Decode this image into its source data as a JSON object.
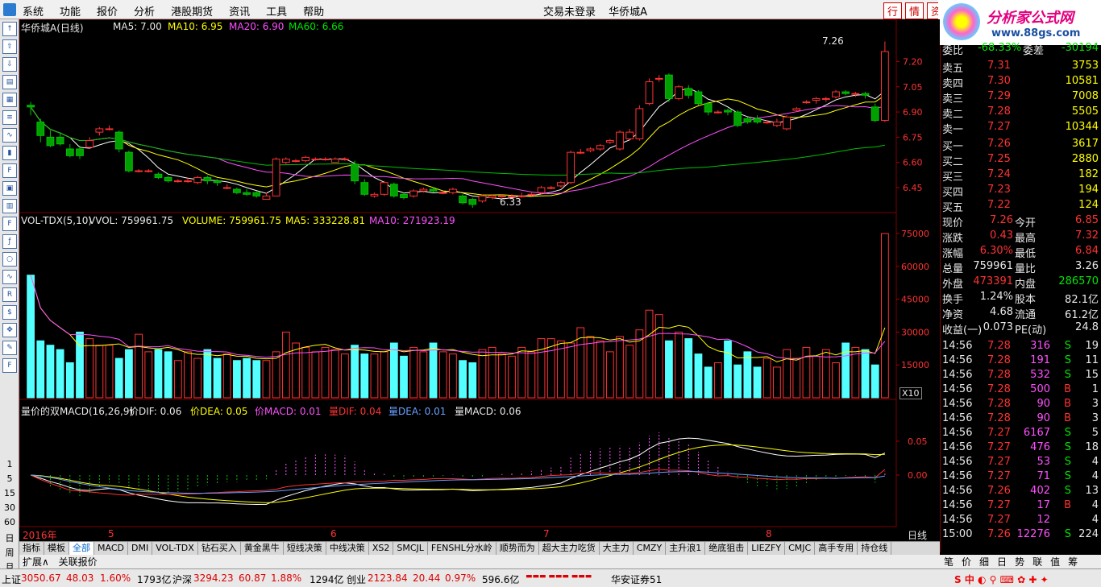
{
  "menu": {
    "items": [
      "系统",
      "功能",
      "报价",
      "分析",
      "港股期货",
      "资讯",
      "工具",
      "帮助"
    ],
    "login": "交易未登录",
    "stock_name": "华侨城A",
    "tab_quote": "行",
    "tab_info": "情",
    "tab_misc": "资"
  },
  "brand": {
    "title": "分析家公式网",
    "url": "www.88gs.com"
  },
  "stock_title": "华侨城A(日线)",
  "ma": {
    "ma5": "MA5: 7.00",
    "ma10": "MA10: 6.95",
    "ma20": "MA20: 6.90",
    "ma60": "MA60: 6.66"
  },
  "price_axis": [
    "7.20",
    "7.05",
    "6.90",
    "6.75",
    "6.60",
    "6.45"
  ],
  "price_annot": {
    "high": "7.26",
    "low": "6.33"
  },
  "vol_header": {
    "name": "VOL-TDX(5,10)",
    "vvol": "VVOL: 759961.75",
    "volume": "VOLUME: 759961.75",
    "ma5": "MA5: 333228.81",
    "ma10": "MA10: 271923.19"
  },
  "vol_axis": [
    "75000",
    "60000",
    "45000",
    "30000",
    "15000"
  ],
  "vol_scale": "X10",
  "macd_header": {
    "name": "量价的双MACD(16,26,9)",
    "dif": "价DIF: 0.06",
    "dea": "价DEA: 0.05",
    "macd": "价MACD: 0.01",
    "qdif": "量DIF: 0.04",
    "qdea": "量DEA: 0.01",
    "qmacd": "量MACD: 0.06"
  },
  "macd_axis": [
    "0.05",
    "0.00"
  ],
  "x_axis": {
    "year": "2016年",
    "m5": "5",
    "m6": "6",
    "m7": "7",
    "m8": "8",
    "period": "日线"
  },
  "left_labels": [
    "1",
    "5",
    "15",
    "30",
    "60",
    "日",
    "周",
    "月"
  ],
  "tabs": [
    "指标",
    "模板",
    "全部",
    "MACD",
    "DMI",
    "VOL-TDX",
    "钻石买入",
    "黄金黑牛",
    "短线决策",
    "中线决策",
    "XS2",
    "SMCJL",
    "FENSHL分水岭",
    "顺势而为",
    "超大主力吃货",
    "大主力",
    "CMZY",
    "主升浪1",
    "绝底狙击",
    "LIEZFY",
    "CMJC",
    "高手专用",
    "持仓线"
  ],
  "tabs_extra": [
    "扩展∧",
    "关联报价"
  ],
  "right_tabs": [
    "笔",
    "价",
    "细",
    "日",
    "势",
    "联",
    "值",
    "筹"
  ],
  "panel": {
    "ratio": {
      "label1": "委比",
      "val1": "-68.33%",
      "label2": "委差",
      "val2": "-30194"
    },
    "sell": [
      {
        "label": "卖五",
        "price": "7.31",
        "vol": "3753"
      },
      {
        "label": "卖四",
        "price": "7.30",
        "vol": "10581"
      },
      {
        "label": "卖三",
        "price": "7.29",
        "vol": "7008"
      },
      {
        "label": "卖二",
        "price": "7.28",
        "vol": "5505"
      },
      {
        "label": "卖一",
        "price": "7.27",
        "vol": "10344"
      }
    ],
    "buy": [
      {
        "label": "买一",
        "price": "7.26",
        "vol": "3617"
      },
      {
        "label": "买二",
        "price": "7.25",
        "vol": "2880"
      },
      {
        "label": "买三",
        "price": "7.24",
        "vol": "182"
      },
      {
        "label": "买四",
        "price": "7.23",
        "vol": "194"
      },
      {
        "label": "买五",
        "price": "7.22",
        "vol": "124"
      }
    ],
    "stats": [
      {
        "l1": "现价",
        "v1": "7.26",
        "l2": "今开",
        "v2": "6.85"
      },
      {
        "l1": "涨跌",
        "v1": "0.43",
        "l2": "最高",
        "v2": "7.32"
      },
      {
        "l1": "涨幅",
        "v1": "6.30%",
        "l2": "最低",
        "v2": "6.84"
      },
      {
        "l1": "总量",
        "v1": "759961",
        "l2": "量比",
        "v2": "3.26"
      },
      {
        "l1": "外盘",
        "v1": "473391",
        "l2": "内盘",
        "v2": "286570"
      },
      {
        "l1": "换手",
        "v1": "1.24%",
        "l2": "股本",
        "v2": "82.1亿"
      },
      {
        "l1": "净资",
        "v1": "4.68",
        "l2": "流通",
        "v2": "61.2亿"
      },
      {
        "l1": "收益(一)",
        "v1": "0.073",
        "l2": "PE(动)",
        "v2": "24.8"
      }
    ],
    "ticks": [
      {
        "t": "14:56",
        "p": "7.28",
        "v": "316",
        "bs": "S",
        "n": "19"
      },
      {
        "t": "14:56",
        "p": "7.28",
        "v": "191",
        "bs": "S",
        "n": "11"
      },
      {
        "t": "14:56",
        "p": "7.28",
        "v": "532",
        "bs": "S",
        "n": "15"
      },
      {
        "t": "14:56",
        "p": "7.28",
        "v": "500",
        "bs": "B",
        "n": "1"
      },
      {
        "t": "14:56",
        "p": "7.28",
        "v": "90",
        "bs": "B",
        "n": "3"
      },
      {
        "t": "14:56",
        "p": "7.28",
        "v": "90",
        "bs": "B",
        "n": "3"
      },
      {
        "t": "14:56",
        "p": "7.27",
        "v": "6167",
        "bs": "S",
        "n": "5"
      },
      {
        "t": "14:56",
        "p": "7.27",
        "v": "476",
        "bs": "S",
        "n": "18"
      },
      {
        "t": "14:56",
        "p": "7.27",
        "v": "53",
        "bs": "S",
        "n": "4"
      },
      {
        "t": "14:56",
        "p": "7.27",
        "v": "71",
        "bs": "S",
        "n": "4"
      },
      {
        "t": "14:56",
        "p": "7.26",
        "v": "402",
        "bs": "S",
        "n": "13"
      },
      {
        "t": "14:56",
        "p": "7.27",
        "v": "17",
        "bs": "B",
        "n": "4"
      },
      {
        "t": "14:56",
        "p": "7.27",
        "v": "12",
        "bs": "",
        "n": "4"
      },
      {
        "t": "15:00",
        "p": "7.26",
        "v": "12276",
        "bs": "S",
        "n": "224"
      }
    ]
  },
  "status": {
    "sh_label": "上证",
    "sh_val": "3050.67",
    "sh_chg": "48.03",
    "sh_pct": "1.60%",
    "sh_amt": "1793亿",
    "hs_label": "沪深",
    "hs_val": "3294.23",
    "hs_chg": "60.87",
    "hs_pct": "1.88%",
    "hs_amt": "1294亿",
    "cy_label": "创业",
    "cy_val": "2123.84",
    "cy_chg": "20.44",
    "cy_pct": "0.97%",
    "cy_amt": "596.6亿",
    "broker": "华安证券51"
  },
  "colors": {
    "up": "#ff3232",
    "down": "#00a000",
    "vol_down": "#54ffff",
    "ma5": "#ffffff",
    "ma10": "#ffff00",
    "ma20": "#ff50ff",
    "ma60": "#00c000"
  },
  "chart_data": {
    "type": "candlestick",
    "candles": [
      [
        6.94,
        6.93,
        6.96,
        6.88
      ],
      [
        6.84,
        6.76,
        6.86,
        6.72
      ],
      [
        6.75,
        6.7,
        6.79,
        6.69
      ],
      [
        6.75,
        6.71,
        6.78,
        6.7
      ],
      [
        6.68,
        6.64,
        6.71,
        6.63
      ],
      [
        6.68,
        6.64,
        6.7,
        6.62
      ],
      [
        6.69,
        6.73,
        6.75,
        6.68
      ],
      [
        6.78,
        6.8,
        6.81,
        6.76
      ],
      [
        6.8,
        6.8,
        6.82,
        6.79
      ],
      [
        6.78,
        6.68,
        6.79,
        6.66
      ],
      [
        6.66,
        6.55,
        6.67,
        6.54
      ],
      [
        6.55,
        6.55,
        6.56,
        6.54
      ],
      [
        6.55,
        6.55,
        6.56,
        6.54
      ],
      [
        6.53,
        6.51,
        6.54,
        6.5
      ],
      [
        6.51,
        6.49,
        6.52,
        6.48
      ],
      [
        6.49,
        6.49,
        6.5,
        6.48
      ],
      [
        6.49,
        6.49,
        6.51,
        6.48
      ],
      [
        6.48,
        6.51,
        6.52,
        6.47
      ],
      [
        6.51,
        6.49,
        6.52,
        6.47
      ],
      [
        6.49,
        6.48,
        6.5,
        6.46
      ],
      [
        6.45,
        6.45,
        6.47,
        6.44
      ],
      [
        6.44,
        6.42,
        6.45,
        6.41
      ],
      [
        6.42,
        6.41,
        6.44,
        6.4
      ],
      [
        6.42,
        6.4,
        6.43,
        6.39
      ],
      [
        6.38,
        6.4,
        6.42,
        6.38
      ],
      [
        6.4,
        6.62,
        6.63,
        6.4
      ],
      [
        6.6,
        6.62,
        6.63,
        6.59
      ],
      [
        6.61,
        6.61,
        6.62,
        6.6
      ],
      [
        6.61,
        6.63,
        6.64,
        6.6
      ],
      [
        6.62,
        6.62,
        6.63,
        6.61
      ],
      [
        6.62,
        6.62,
        6.63,
        6.61
      ],
      [
        6.6,
        6.62,
        6.63,
        6.6
      ],
      [
        6.62,
        6.62,
        6.63,
        6.61
      ],
      [
        6.59,
        6.49,
        6.61,
        6.47
      ],
      [
        6.48,
        6.41,
        6.5,
        6.4
      ],
      [
        6.4,
        6.41,
        6.42,
        6.39
      ],
      [
        6.41,
        6.48,
        6.49,
        6.4
      ],
      [
        6.47,
        6.4,
        6.48,
        6.39
      ],
      [
        6.41,
        6.39,
        6.42,
        6.38
      ],
      [
        6.4,
        6.43,
        6.44,
        6.39
      ],
      [
        6.43,
        6.44,
        6.45,
        6.42
      ],
      [
        6.44,
        6.43,
        6.45,
        6.42
      ],
      [
        6.42,
        6.42,
        6.43,
        6.41
      ],
      [
        6.42,
        6.44,
        6.45,
        6.41
      ],
      [
        6.4,
        6.36,
        6.41,
        6.35
      ],
      [
        6.38,
        6.35,
        6.39,
        6.33
      ],
      [
        6.37,
        6.4,
        6.41,
        6.36
      ],
      [
        6.39,
        6.4,
        6.41,
        6.38
      ],
      [
        6.4,
        6.4,
        6.41,
        6.39
      ],
      [
        6.4,
        6.4,
        6.41,
        6.39
      ],
      [
        6.4,
        6.4,
        6.42,
        6.39
      ],
      [
        6.41,
        6.41,
        6.42,
        6.4
      ],
      [
        6.42,
        6.45,
        6.46,
        6.41
      ],
      [
        6.45,
        6.45,
        6.46,
        6.44
      ],
      [
        6.46,
        6.48,
        6.49,
        6.45
      ],
      [
        6.48,
        6.66,
        6.67,
        6.47
      ],
      [
        6.66,
        6.66,
        6.68,
        6.65
      ],
      [
        6.67,
        6.68,
        6.69,
        6.66
      ],
      [
        6.68,
        6.7,
        6.71,
        6.67
      ],
      [
        6.72,
        6.73,
        6.74,
        6.71
      ],
      [
        6.68,
        6.78,
        6.79,
        6.67
      ],
      [
        6.74,
        6.78,
        6.8,
        6.73
      ],
      [
        6.74,
        6.92,
        6.94,
        6.73
      ],
      [
        6.95,
        7.08,
        7.1,
        6.94
      ],
      [
        7.1,
        7.1,
        7.12,
        7.08
      ],
      [
        7.12,
        6.98,
        7.13,
        6.96
      ],
      [
        6.98,
        7.05,
        7.06,
        6.97
      ],
      [
        7.04,
        7.0,
        7.06,
        6.98
      ],
      [
        7.02,
        6.95,
        7.03,
        6.94
      ],
      [
        6.95,
        6.9,
        6.96,
        6.88
      ],
      [
        6.9,
        6.9,
        6.91,
        6.89
      ],
      [
        6.91,
        6.9,
        6.92,
        6.88
      ],
      [
        6.9,
        6.82,
        6.91,
        6.81
      ],
      [
        6.86,
        6.84,
        6.87,
        6.83
      ],
      [
        6.86,
        6.84,
        6.88,
        6.83
      ],
      [
        6.84,
        6.84,
        6.85,
        6.83
      ],
      [
        6.82,
        6.84,
        6.86,
        6.81
      ],
      [
        6.8,
        6.87,
        6.88,
        6.79
      ],
      [
        6.91,
        6.92,
        6.93,
        6.9
      ],
      [
        6.96,
        6.96,
        6.97,
        6.95
      ],
      [
        6.97,
        6.98,
        6.99,
        6.95
      ],
      [
        6.98,
        6.98,
        6.99,
        6.96
      ],
      [
        6.99,
        7.02,
        7.03,
        6.98
      ],
      [
        7.02,
        7.01,
        7.03,
        7.0
      ],
      [
        7.01,
        7.01,
        7.02,
        6.99
      ],
      [
        7.01,
        7.0,
        7.02,
        6.98
      ],
      [
        6.93,
        6.85,
        6.95,
        6.84
      ],
      [
        6.85,
        7.26,
        7.32,
        6.84
      ]
    ],
    "volume": [
      56000,
      26000,
      24000,
      22000,
      16000,
      30000,
      27000,
      24000,
      24000,
      18000,
      22000,
      29000,
      21000,
      22000,
      21000,
      17000,
      21000,
      18000,
      22000,
      18000,
      20000,
      17000,
      18000,
      17000,
      17000,
      21000,
      30000,
      25000,
      23000,
      21000,
      23000,
      22000,
      20000,
      24000,
      20000,
      20000,
      21000,
      25000,
      19000,
      23000,
      21000,
      25000,
      21000,
      20000,
      17000,
      16000,
      22000,
      23000,
      20000,
      19000,
      23000,
      21000,
      27000,
      27000,
      26000,
      25000,
      32000,
      28000,
      26000,
      21000,
      28000,
      24000,
      31000,
      40000,
      38000,
      26000,
      30000,
      27000,
      20000,
      14000,
      16000,
      26000,
      15000,
      21000,
      14000,
      18000,
      14000,
      22000,
      18000,
      23000,
      19000,
      22000,
      16000,
      25000,
      23000,
      22000,
      15000,
      75000
    ],
    "ylim_price": [
      6.33,
      7.26
    ],
    "ylim_volume": [
      0,
      75000
    ]
  }
}
